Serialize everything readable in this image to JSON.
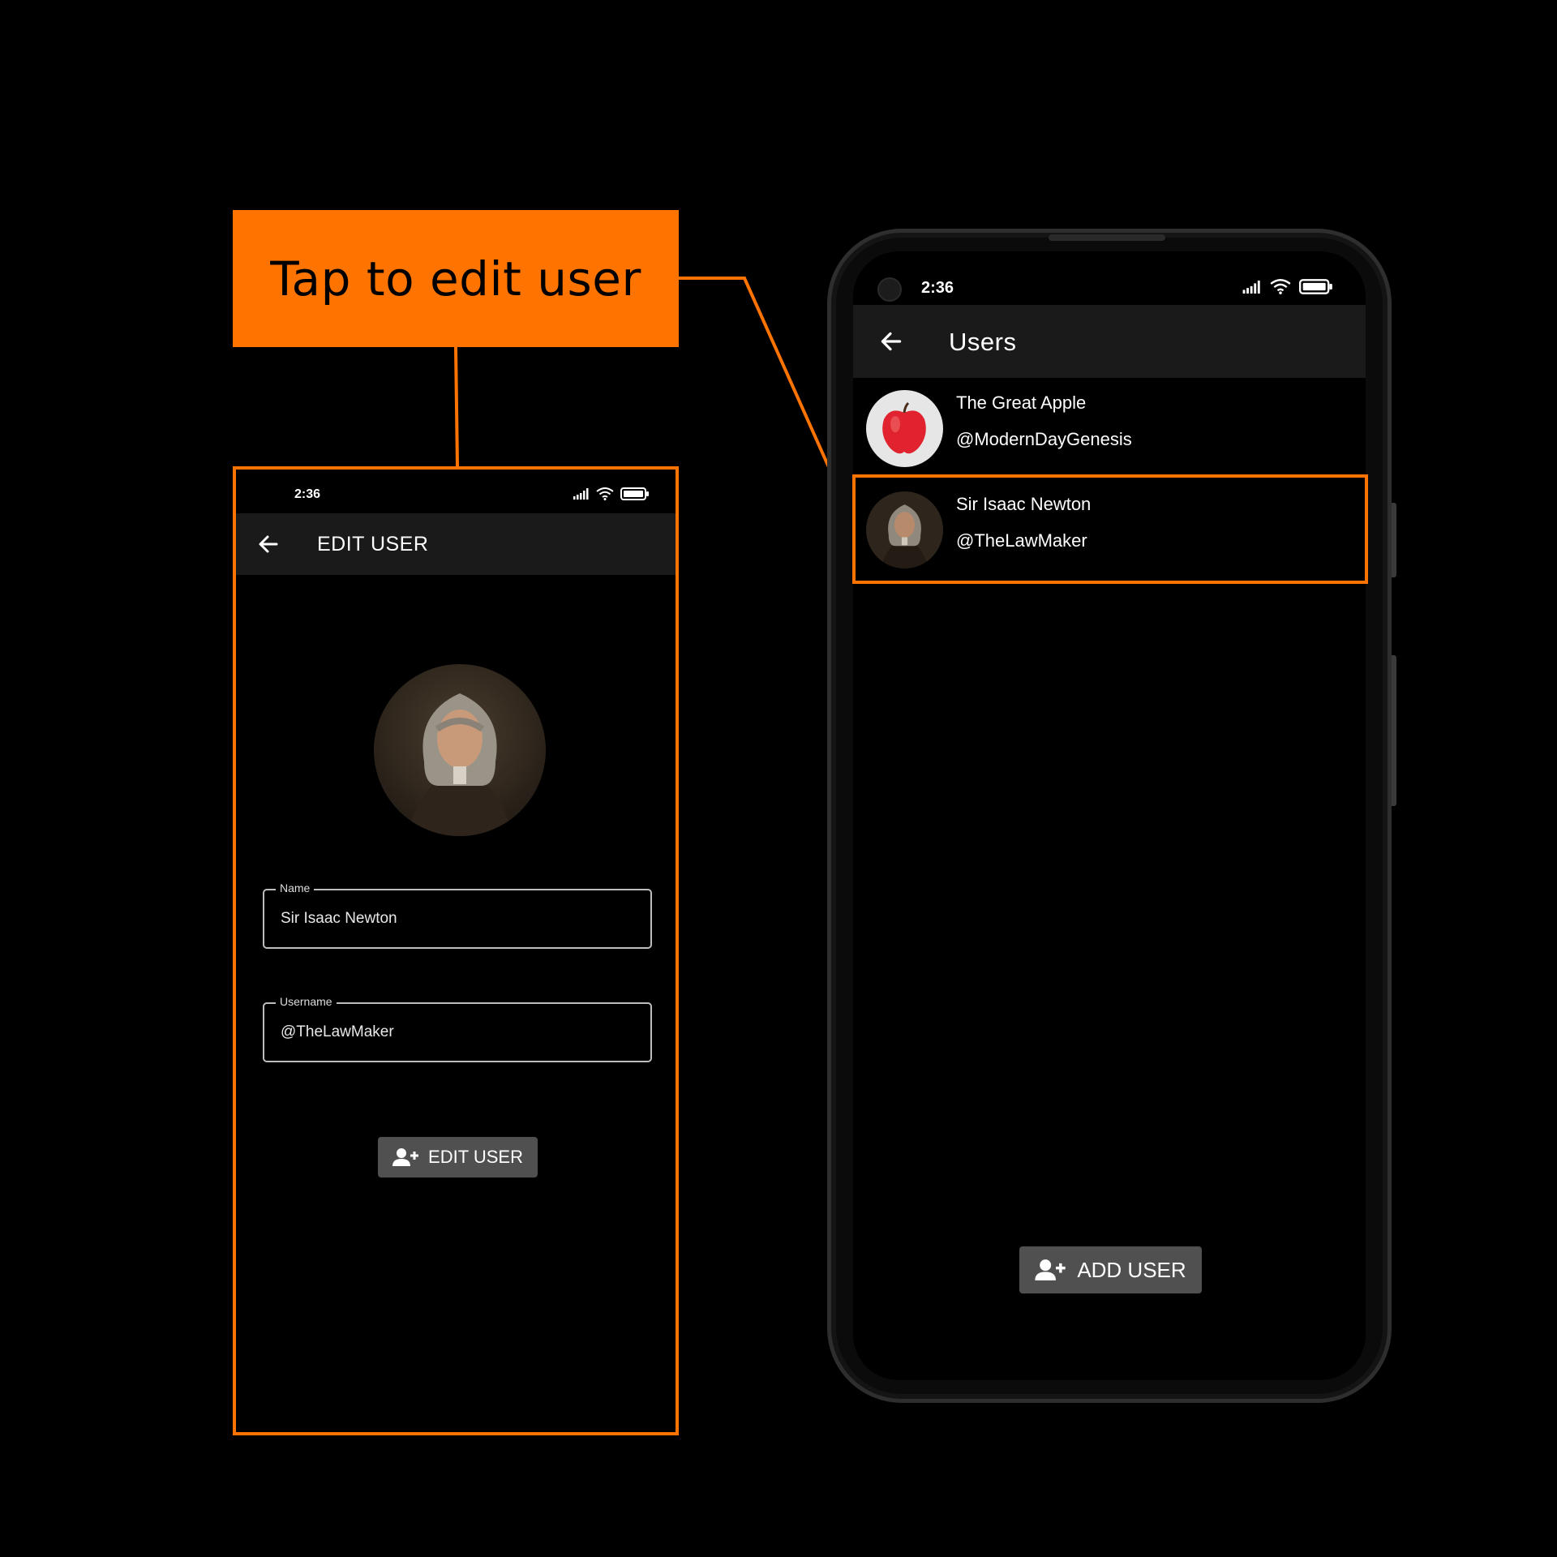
{
  "callout": {
    "text": "Tap to edit user"
  },
  "edit_screen": {
    "status_time": "2:36",
    "title": "EDIT USER",
    "name_field": {
      "label": "Name",
      "value": "Sir Isaac Newton"
    },
    "username_field": {
      "label": "Username",
      "value": "@TheLawMaker"
    },
    "submit_label": "EDIT USER"
  },
  "users_screen": {
    "status_time": "2:36",
    "title": "Users",
    "users": [
      {
        "name": "The Great Apple",
        "handle": "@ModernDayGenesis",
        "avatar_icon": "apple-avatar"
      },
      {
        "name": "Sir Isaac Newton",
        "handle": "@TheLawMaker",
        "avatar_icon": "newton-portrait-avatar"
      }
    ],
    "add_label": "ADD USER"
  },
  "colors": {
    "accent": "#ff7400",
    "appbar": "#1a1a1a",
    "button": "#505050",
    "background": "#000000"
  }
}
